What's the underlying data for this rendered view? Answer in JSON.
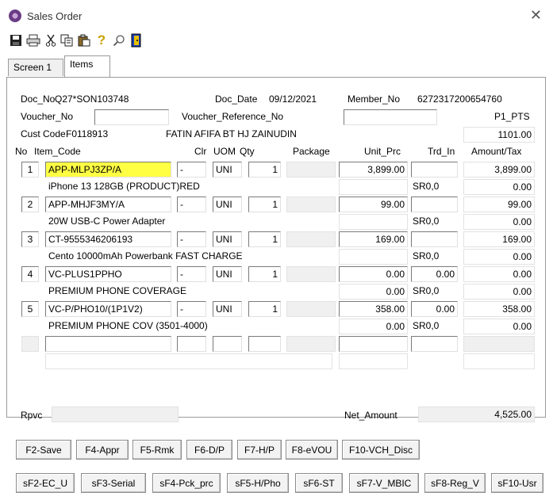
{
  "window": {
    "title": "Sales Order",
    "close_symbol": "✕"
  },
  "toolbar": {
    "icons": [
      "save-icon",
      "print-icon",
      "cut-icon",
      "copy-icon",
      "paste-icon",
      "help-icon",
      "search-icon",
      "exit-icon"
    ]
  },
  "tabs": {
    "screen1": "Screen 1",
    "items": "Items"
  },
  "header": {
    "doc_no_label": "Doc_No",
    "doc_no": "Q27*SON103748",
    "doc_date_label": "Doc_Date",
    "doc_date": "09/12/2021",
    "member_no_label": "Member_No",
    "member_no": "6272317200654760",
    "voucher_no_label": "Voucher_No",
    "voucher_no": "",
    "voucher_ref_label": "Voucher_Reference_No",
    "voucher_ref": "",
    "p1_pts": "P1_PTS",
    "cust_code_label": "Cust Code",
    "cust_code": "F0118913",
    "cust_name": "FATIN AFIFA BT HJ ZAINUDIN",
    "points": "1101.00"
  },
  "columns": {
    "no": "No",
    "item_code": "Item_Code",
    "clr": "Clr",
    "uom": "UOM",
    "qty": "Qty",
    "package": "Package",
    "unit_prc": "Unit_Prc",
    "trd_in": "Trd_In",
    "amount_tax": "Amount/Tax"
  },
  "rows": [
    {
      "no": "1",
      "code": "APP-MLPJ3ZP/A",
      "clr": "-",
      "uom": "UNI",
      "qty": "1",
      "unit_prc": "3,899.00",
      "trd_in": "",
      "amount": "3,899.00",
      "desc": "iPhone 13 128GB (PRODUCT)RED",
      "desc_prc": "",
      "tax_code": "SR0,0",
      "tax": "0.00"
    },
    {
      "no": "2",
      "code": "APP-MHJF3MY/A",
      "clr": "-",
      "uom": "UNI",
      "qty": "1",
      "unit_prc": "99.00",
      "trd_in": "",
      "amount": "99.00",
      "desc": "20W USB-C Power Adapter",
      "desc_prc": "",
      "tax_code": "SR0,0",
      "tax": "0.00"
    },
    {
      "no": "3",
      "code": "CT-9555346206193",
      "clr": "-",
      "uom": "UNI",
      "qty": "1",
      "unit_prc": "169.00",
      "trd_in": "",
      "amount": "169.00",
      "desc": "Cento 10000mAh Powerbank FAST CHARGE",
      "desc_prc": "",
      "tax_code": "SR0,0",
      "tax": "0.00"
    },
    {
      "no": "4",
      "code": "VC-PLUS1PPHO",
      "clr": "-",
      "uom": "UNI",
      "qty": "1",
      "unit_prc": "0.00",
      "trd_in": "0.00",
      "amount": "0.00",
      "desc": "PREMIUM PHONE COVERAGE",
      "desc_prc": "0.00",
      "tax_code": "SR0,0",
      "tax": "0.00"
    },
    {
      "no": "5",
      "code": "VC-P/PHO10/(1P1V2)",
      "clr": "-",
      "uom": "UNI",
      "qty": "1",
      "unit_prc": "358.00",
      "trd_in": "0.00",
      "amount": "358.00",
      "desc": "PREMIUM PHONE COV (3501-4000)",
      "desc_prc": "0.00",
      "tax_code": "SR0,0",
      "tax": "0.00"
    }
  ],
  "footer": {
    "rpvc_label": "Rpvc",
    "rpvc": "",
    "net_amount_label": "Net_Amount",
    "net_amount": "4,525.00"
  },
  "buttons_row1": [
    "F2-Save",
    "F4-Appr",
    "F5-Rmk",
    "F6-D/P",
    "F7-H/P",
    "F8-eVOU",
    "F10-VCH_Disc"
  ],
  "buttons_row2": [
    "sF2-EC_U",
    "sF3-Serial",
    "sF4-Pck_prc",
    "sF5-H/Pho",
    "sF6-ST",
    "sF7-V_MBIC",
    "sF8-Reg_V",
    "sF10-Usr"
  ]
}
